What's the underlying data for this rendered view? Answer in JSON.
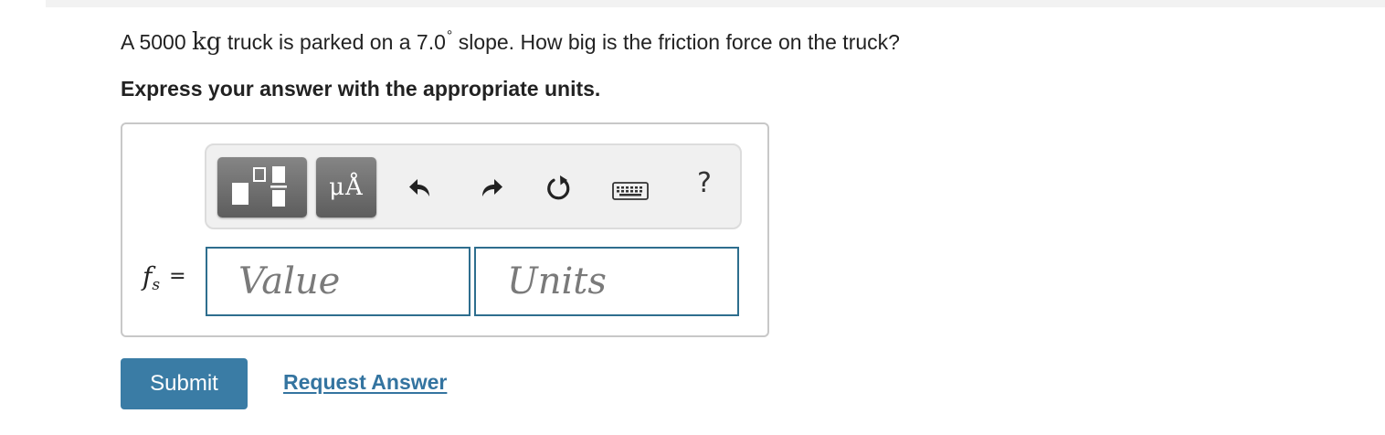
{
  "question": {
    "prefix": "A 5000 ",
    "mass_unit": "kg",
    "middle": " truck is parked on a 7.0",
    "degree_symbol": "°",
    "suffix": "  slope. How big is the friction force on the truck?"
  },
  "instruction": "Express your answer with the appropriate units.",
  "toolbar": {
    "units_button_label": "μÅ",
    "help_label": "?",
    "icons": [
      "templates-icon",
      "undo-icon",
      "redo-icon",
      "reset-icon",
      "keyboard-icon"
    ]
  },
  "answer": {
    "variable": "f",
    "variable_subscript": "s",
    "equals": "=",
    "value_placeholder": "Value",
    "units_placeholder": "Units"
  },
  "actions": {
    "submit_label": "Submit",
    "request_answer_label": "Request Answer"
  },
  "colors": {
    "accent": "#3a7ca5",
    "link": "#3474a0",
    "field_border": "#2e6e8e",
    "toolbar_button": "#6e6e6e"
  }
}
